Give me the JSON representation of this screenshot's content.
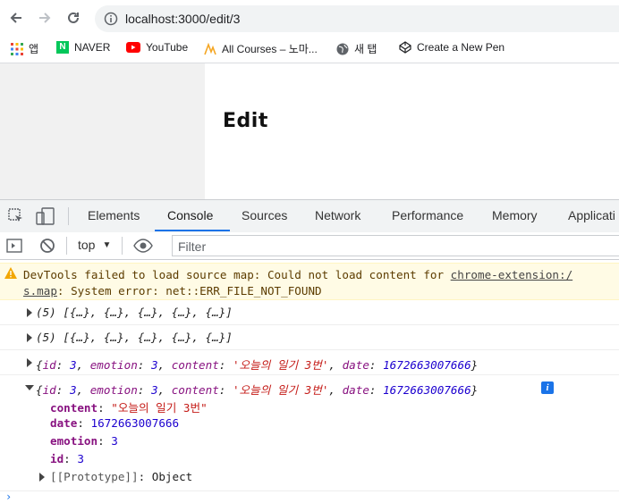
{
  "browser": {
    "url": "localhost:3000/edit/3",
    "bookmarks": [
      "앱",
      "NAVER",
      "YouTube",
      "All Courses – 노마...",
      "새 탭",
      "Create a New Pen"
    ]
  },
  "page": {
    "title": "Edit"
  },
  "devtools": {
    "tabs": [
      "Elements",
      "Console",
      "Sources",
      "Network",
      "Performance",
      "Memory",
      "Applicati"
    ],
    "context": "top",
    "filter_placeholder": "Filter",
    "warning_line1_prefix": "DevTools failed to load source map: Could not load content for ",
    "warning_link": "chrome-extension:/",
    "warning_line2_link": "s.map",
    "warning_line2_rest": ": System error: net::ERR_FILE_NOT_FOUND",
    "logs": [
      "(5) [{…}, {…}, {…}, {…}, {…}]",
      "(5) [{…}, {…}, {…}, {…}, {…}]"
    ],
    "object_summary": {
      "id_key": "id",
      "id_val": "3",
      "emotion_key": "emotion",
      "emotion_val": "3",
      "content_key": "content",
      "content_val": "'오늘의 일기 3번'",
      "date_key": "date",
      "date_val": "1672663007666"
    },
    "expanded": {
      "content_key": "content",
      "content_val": "\"오늘의 일기 3번\"",
      "date_key": "date",
      "date_val": "1672663007666",
      "emotion_key": "emotion",
      "emotion_val": "3",
      "id_key": "id",
      "id_val": "3",
      "proto_key": "[[Prototype]]",
      "proto_val": "Object"
    },
    "info_badge": "i"
  }
}
